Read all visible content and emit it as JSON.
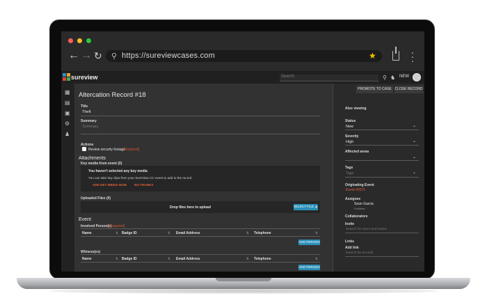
{
  "browser": {
    "url": "https://sureviewcases.com",
    "colors": {
      "close": "#ff5f57",
      "minimize": "#febc2e",
      "zoom": "#28c840",
      "star": "#f2c300"
    }
  },
  "topbar": {
    "brand": "sureview",
    "search_placeholder": "Search",
    "new_label": "NEW"
  },
  "record": {
    "heading": "Altercation Record #18",
    "title_label": "Title",
    "title_value": "Theft",
    "summary_label": "Summary",
    "summary_placeholder": "Summary",
    "actions_label": "Actions",
    "action_item": "Review security footage",
    "required": "[Required]"
  },
  "attachments": {
    "heading": "Attachments",
    "key_media_label": "Key media from event (0)",
    "empty_title": "You haven't selected any key media",
    "empty_text": "You can take key clips from your SureView CC event to add to the record.",
    "add_key_media": "ADD KEY MEDIA NOW",
    "no_thanks": "NO THANKS",
    "uploaded_label": "Uploaded Files (0)",
    "drop_text": "Drop files here to upload",
    "select_file": "SELECT FILE"
  },
  "event": {
    "heading": "Event",
    "involved_label": "Involved Person(s)",
    "witness_label": "Witness(es)",
    "required": "[Required]",
    "columns": [
      "Name",
      "Badge ID",
      "Email Address",
      "Telephone"
    ],
    "add_person": "ADD PERSON"
  },
  "side": {
    "promote_btn": "PROMOTE TO CASE",
    "close_btn": "CLOSE RECORD",
    "also_viewing": "Also viewing",
    "status_label": "Status",
    "status_value": "New",
    "severity_label": "Severity",
    "severity_value": "High",
    "affected_label": "Affected areas",
    "tags_label": "Tags",
    "tags_placeholder": "Tags",
    "orig_label": "Originating Event",
    "orig_value": "Event #6571",
    "assignee_label": "Assignee",
    "assignee_name": "Sean Garcia",
    "assignee_team": "Facilities",
    "collab_label": "Collaborators",
    "invite_label": "Invite",
    "invite_placeholder": "Search for users and teams",
    "links_label": "Links",
    "add_link_label": "Add link",
    "add_link_placeholder": "Search for records"
  }
}
